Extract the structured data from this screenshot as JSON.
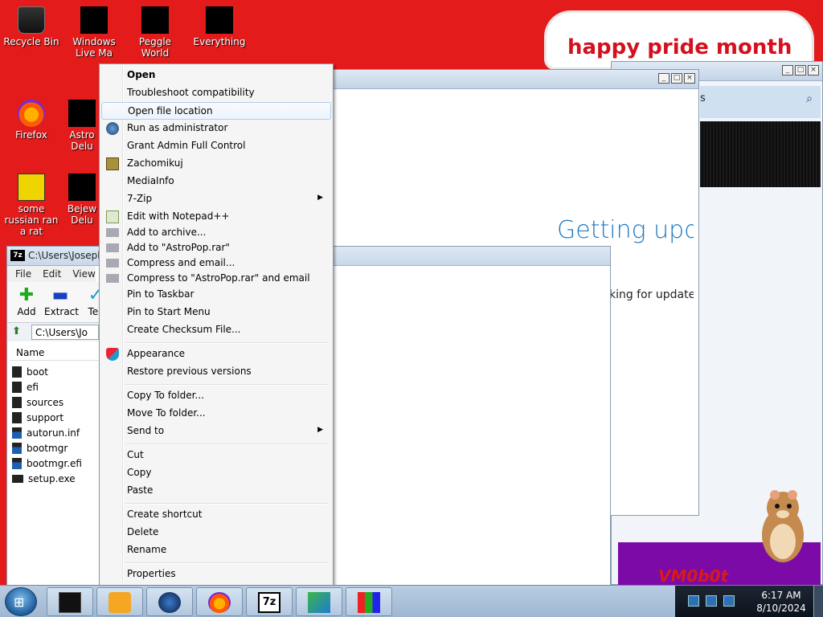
{
  "desktop": {
    "icons": [
      {
        "label": "Recycle Bin",
        "icon": "recycle-bin-icon"
      },
      {
        "label": "Windows Live Ma",
        "icon": "windows-live-mail-icon"
      },
      {
        "label": "Peggle World",
        "icon": "peggle-world-icon"
      },
      {
        "label": "Everything",
        "icon": "everything-search-icon"
      },
      {
        "label": "Firefox",
        "icon": "firefox-icon"
      },
      {
        "label": "Astro Delu",
        "icon": "astropop-deluxe-icon"
      },
      {
        "label": "some russian ran a rat",
        "icon": "document-icon"
      },
      {
        "label": "Bejew Delu",
        "icon": "bejeweled-deluxe-icon"
      }
    ],
    "banner_text": "happy pride month"
  },
  "update_window": {
    "heading": "Getting upda",
    "status": "Checking for updates"
  },
  "explorer_window": {
    "search_label": "s",
    "bottom_banner": "VM0b0t"
  },
  "sevenzip": {
    "title": "C:\\Users\\Joseph",
    "menu": [
      "File",
      "Edit",
      "View"
    ],
    "toolbar": [
      {
        "label": "Add",
        "icon": "add-icon"
      },
      {
        "label": "Extract",
        "icon": "extract-icon"
      },
      {
        "label": "Tes",
        "icon": "test-icon"
      }
    ],
    "path": "C:\\Users\\Jo",
    "column_name": "Name",
    "files": [
      "boot",
      "efi",
      "sources",
      "support",
      "autorun.inf",
      "bootmgr",
      "bootmgr.efi",
      "setup.exe"
    ]
  },
  "context_menu": {
    "items": [
      {
        "label": "Open",
        "bold": true
      },
      {
        "label": "Troubleshoot compatibility"
      },
      {
        "label": "Open file location",
        "highlighted": true
      },
      {
        "label": "Run as administrator",
        "icon": "shield-globe-icon"
      },
      {
        "label": "Grant Admin Full Control"
      },
      {
        "label": "Zachomikuj",
        "icon": "hamster-icon"
      },
      {
        "label": "MediaInfo"
      },
      {
        "label": "7-Zip",
        "submenu": true
      },
      {
        "label": "Edit with Notepad++",
        "icon": "notepad-plus-plus-icon"
      },
      {
        "label": "Add to archive...",
        "icon": "winrar-icon"
      },
      {
        "label": "Add to \"AstroPop.rar\"",
        "icon": "winrar-icon"
      },
      {
        "label": "Compress and email...",
        "icon": "winrar-icon"
      },
      {
        "label": "Compress to \"AstroPop.rar\" and email",
        "icon": "winrar-icon"
      },
      {
        "label": "Pin to Taskbar"
      },
      {
        "label": "Pin to Start Menu"
      },
      {
        "label": "Create Checksum File..."
      },
      {
        "label": "Appearance",
        "icon": "shield-icon"
      },
      {
        "label": "Restore previous versions"
      },
      {
        "label": "Copy To folder..."
      },
      {
        "label": "Move To folder..."
      },
      {
        "label": "Send to",
        "submenu": true
      },
      {
        "label": "Cut"
      },
      {
        "label": "Copy"
      },
      {
        "label": "Paste"
      },
      {
        "label": "Create shortcut"
      },
      {
        "label": "Delete"
      },
      {
        "label": "Rename"
      },
      {
        "label": "Properties"
      }
    ]
  },
  "taskbar": {
    "apps": [
      "app-window-icon",
      "media-player-icon",
      "globe-icon",
      "firefox-icon",
      "7zip-icon",
      "installer-icon",
      "paint-icon"
    ],
    "time": "6:17 AM",
    "date": "8/10/2024"
  }
}
